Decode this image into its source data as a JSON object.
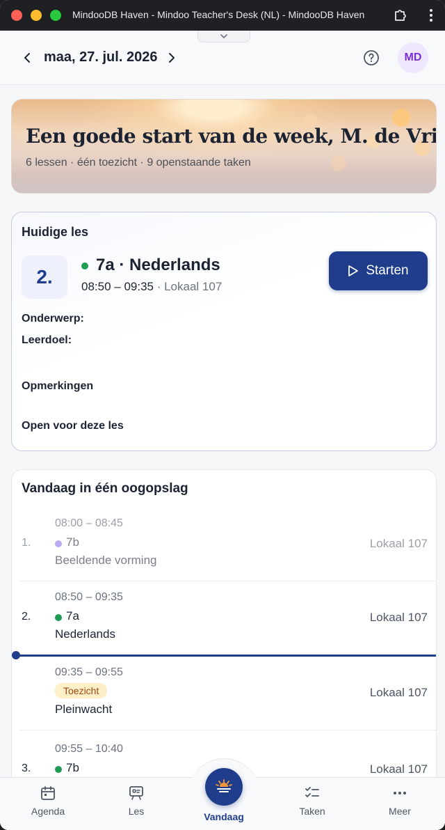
{
  "window": {
    "title": "MindooDB Haven - Mindoo Teacher's Desk (NL) - MindooDB Haven"
  },
  "header": {
    "date": "maa, 27. jul. 2026",
    "avatar_initials": "MD"
  },
  "hero": {
    "title": "Een goede start van de week, M. de Vries",
    "subtitle": "6 lessen · één toezicht · 9 openstaande taken"
  },
  "current_lesson": {
    "label": "Huidige les",
    "period": "2.",
    "class_subject": "7a · Nederlands",
    "time": "08:50 – 09:35",
    "room": "· Lokaal 107",
    "start_label": "Starten",
    "fields": {
      "topic": "Onderwerp:",
      "goal": "Leerdoel:",
      "remarks": "Opmerkingen",
      "open": "Open voor deze les"
    }
  },
  "overview": {
    "title": "Vandaag in één oogopslag",
    "rows": [
      {
        "num": "1.",
        "time": "08:00 – 08:45",
        "class": "7b",
        "dot_color": "#b8a9f0",
        "subject": "Beeldende vorming",
        "room": "Lokaal 107"
      },
      {
        "num": "2.",
        "time": "08:50 – 09:35",
        "class": "7a",
        "dot_color": "#1f9d55",
        "subject": "Nederlands",
        "room": "Lokaal 107"
      },
      {
        "num": "",
        "time": "09:35 – 09:55",
        "badge": "Toezicht",
        "subject": "Pleinwacht",
        "room": "Lokaal 107"
      },
      {
        "num": "3.",
        "time": "09:55 – 10:40",
        "class": "7b",
        "dot_color": "#1f9d55",
        "subject": "",
        "room": "Lokaal 107"
      }
    ]
  },
  "bottom_nav": {
    "agenda": "Agenda",
    "les": "Les",
    "vandaag": "Vandaag",
    "taken": "Taken",
    "meer": "Meer"
  },
  "colors": {
    "accent": "#1f3d8a",
    "green": "#1f9d55",
    "purple": "#b8a9f0",
    "badge_bg": "#fdefc7",
    "badge_text": "#a04a10"
  }
}
